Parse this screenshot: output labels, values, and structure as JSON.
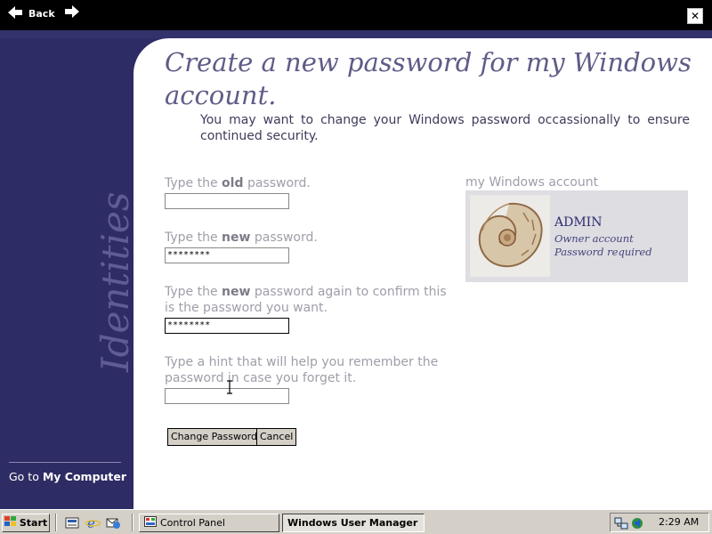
{
  "topbar": {
    "back_label": "Back"
  },
  "sidebar": {
    "goto_prefix": "Go to ",
    "goto_link": "My Computer",
    "watermark": "Identities"
  },
  "main": {
    "title": "Create a new password for my Windows account.",
    "intro": "You may want to change your Windows password occassionally to ensure continued security.",
    "fields": [
      {
        "label_pre": "Type the ",
        "label_bold": "old",
        "label_post": " password.",
        "value": ""
      },
      {
        "label_pre": "Type the ",
        "label_bold": "new",
        "label_post": " password.",
        "value": "********"
      },
      {
        "label_pre": "Type the ",
        "label_bold": "new",
        "label_post": " password again to confirm this is the password you want.",
        "value": "********"
      },
      {
        "label_pre": "Type a hint that will help you remember the password in case you forget it.",
        "label_bold": "",
        "label_post": "",
        "value": ""
      }
    ],
    "change_button": "Change Password",
    "cancel_button": "Cancel"
  },
  "account": {
    "section_label": "my Windows account",
    "name": "ADMIN",
    "type": "Owner account",
    "status": "Password required"
  },
  "taskbar": {
    "start": "Start",
    "tasks": [
      "Control Panel",
      "Windows User Manager"
    ],
    "active_task": "Windows User Manager",
    "clock": "2:29 AM"
  }
}
